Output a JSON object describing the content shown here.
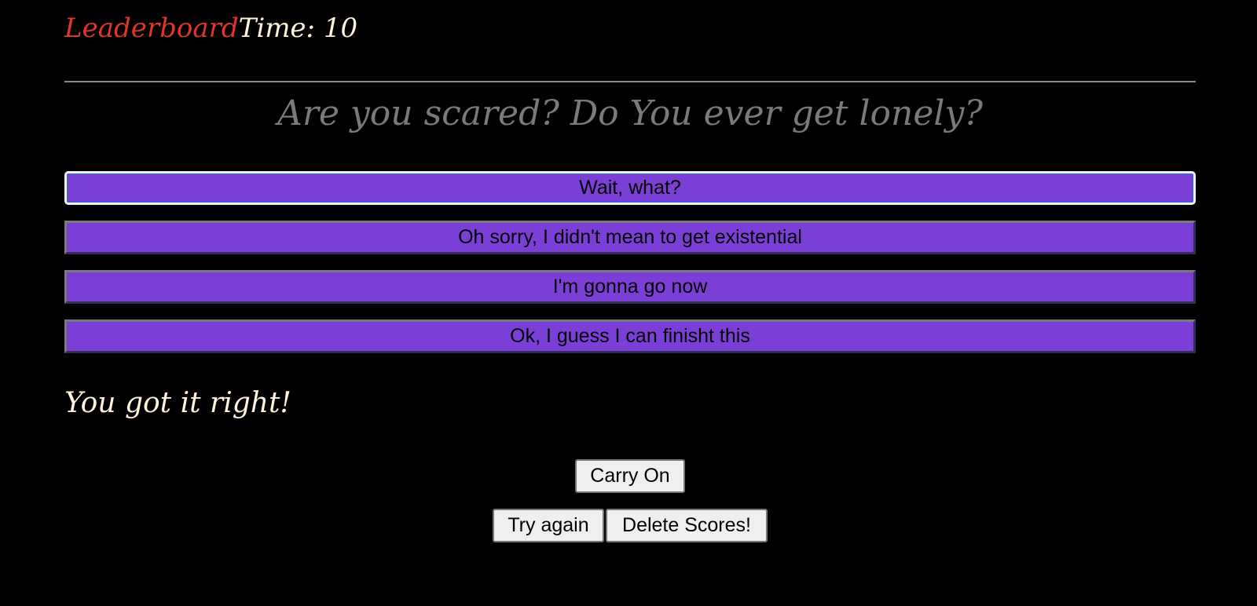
{
  "header": {
    "leaderboard_label": "Leaderboard",
    "time_label": "Time: 10"
  },
  "quiz": {
    "question": "Are you scared? Do You ever get lonely?",
    "answers": [
      "Wait, what?",
      "Oh sorry, I didn't mean to get existential",
      "I'm gonna go now",
      "Ok, I guess I can finisht this"
    ],
    "feedback": "You got it right!"
  },
  "controls": {
    "carry_on_label": "Carry On",
    "try_again_label": "Try again",
    "delete_scores_label": "Delete Scores!"
  },
  "colors": {
    "background": "#000000",
    "leaderboard": "#e0362a",
    "time_text": "#fff3dc",
    "question_text": "#7a7a7a",
    "answer_button": "#7b3fd8",
    "feedback_text": "#fff3dc"
  }
}
